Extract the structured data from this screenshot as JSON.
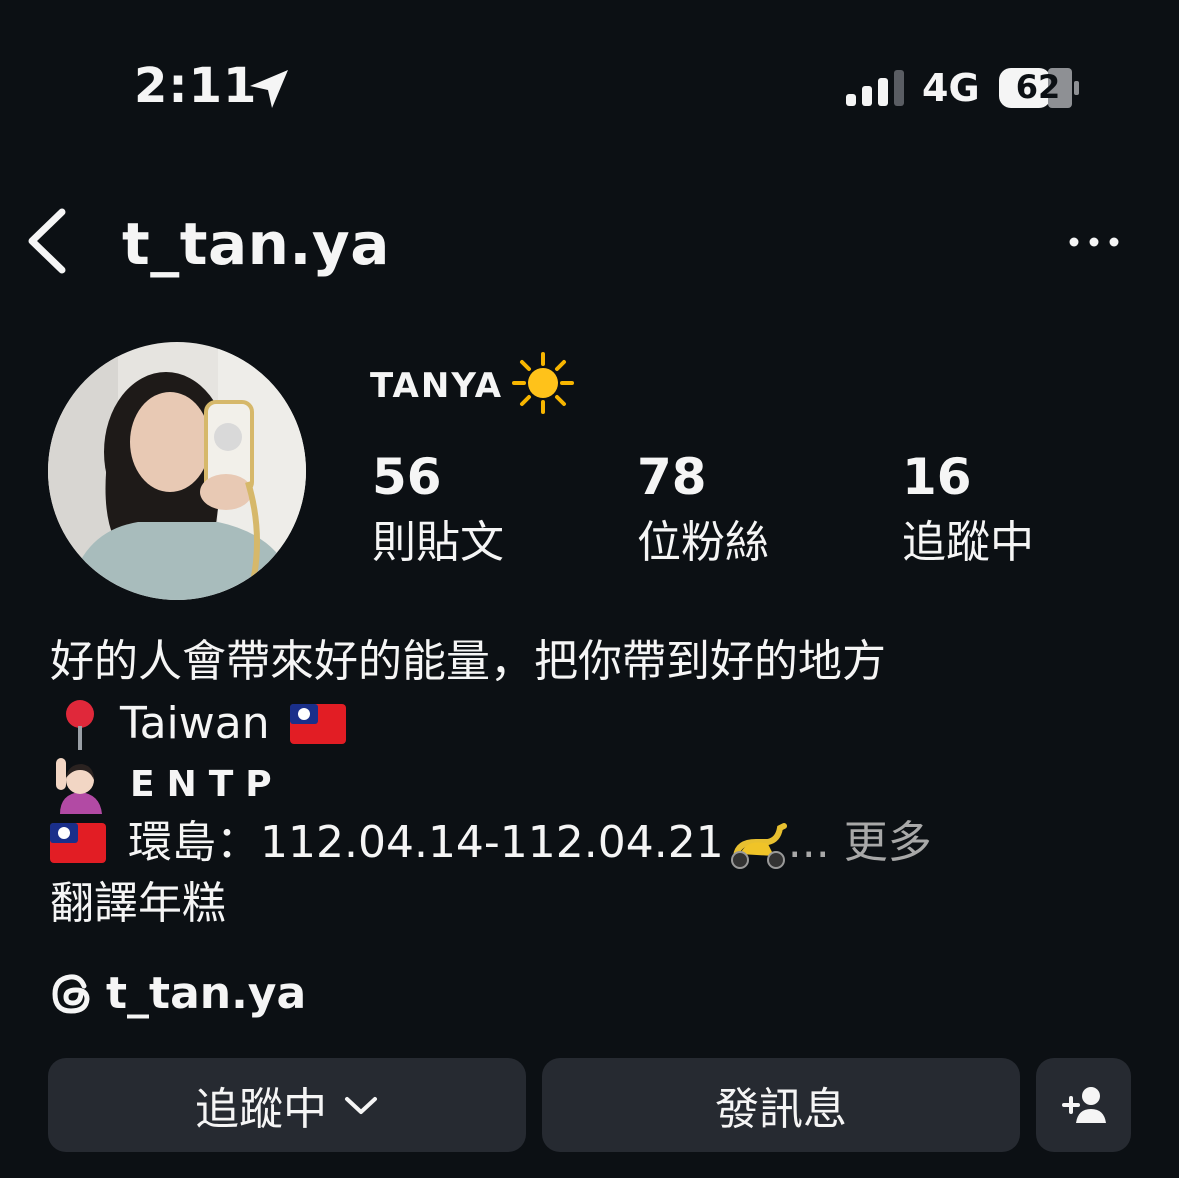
{
  "status_bar": {
    "time": "2:11",
    "network": "4G",
    "battery": "62",
    "icons": [
      "location-arrow-icon",
      "signal-icon",
      "battery-icon"
    ]
  },
  "header": {
    "username": "t_tan.ya",
    "icons": [
      "back-chevron-icon",
      "more-options-icon"
    ]
  },
  "profile": {
    "display_name": "TANYA",
    "stats": [
      {
        "value": "56",
        "label": "則貼文"
      },
      {
        "value": "78",
        "label": "位粉絲"
      },
      {
        "value": "16",
        "label": "追蹤中"
      }
    ],
    "bio": {
      "line1": "好的人會帶來好的能量，把你帶到好的地方",
      "line2": "Taiwan",
      "line3": "ENTP",
      "line4": "環島：112.04.14-112.04.21",
      "ellipsis": "...",
      "more": "更多",
      "line5": "翻譯年糕"
    },
    "threads_handle": "t_tan.ya"
  },
  "actions": {
    "following_label": "追蹤中",
    "message_label": "發訊息"
  },
  "colors": {
    "background": "#0c1014",
    "text": "#f5f5f5",
    "button": "#262a31",
    "muted": "#a8a8a8"
  }
}
